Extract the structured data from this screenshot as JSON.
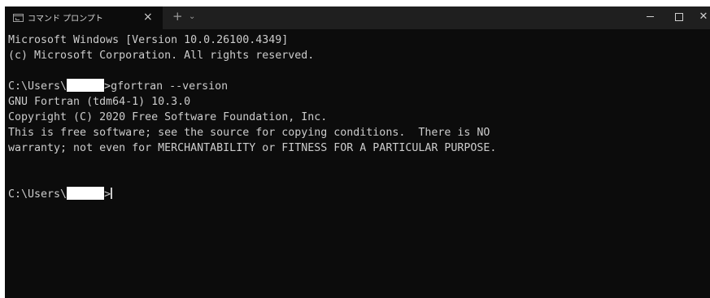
{
  "window": {
    "tab_title": "コマンド プロンプト",
    "tab_close": "×",
    "new_tab": "+",
    "dropdown": "⌄",
    "minimize_icon": "minimize-icon",
    "maximize_icon": "maximize-icon",
    "close_symbol": "✕"
  },
  "console": {
    "lines": [
      "Microsoft Windows [Version 10.0.26100.4349]",
      "(c) Microsoft Corporation. All rights reserved.",
      "",
      "C:\\Users\\",
      "GNU Fortran (tdm64-1) 10.3.0",
      "Copyright (C) 2020 Free Software Foundation, Inc.",
      "This is free software; see the source for copying conditions.  There is NO",
      "warranty; not even for MERCHANTABILITY or FITNESS FOR A PARTICULAR PURPOSE.",
      "",
      "",
      "C:\\Users\\"
    ],
    "command_1": ">gfortran --version",
    "prompt_2": ">"
  }
}
